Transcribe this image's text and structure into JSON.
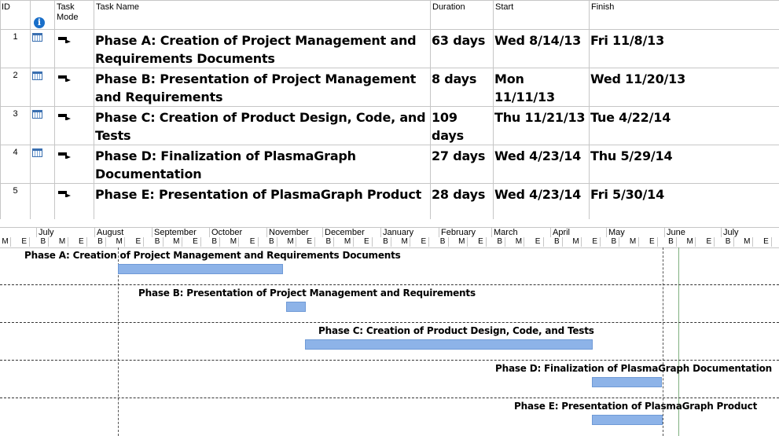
{
  "columns": {
    "id": "ID",
    "task_mode_line1": "Task",
    "task_mode_line2": "Mode",
    "task_name": "Task Name",
    "duration": "Duration",
    "start": "Start",
    "finish": "Finish"
  },
  "tasks": [
    {
      "id": "1",
      "name": "Phase A: Creation of Project Management and Requirements Documents",
      "duration": "63 days",
      "start": "Wed 8/14/13",
      "finish": "Fri 11/8/13",
      "calendar_icon": true
    },
    {
      "id": "2",
      "name": "Phase B: Presentation of Project Management and Requirements",
      "duration": "8 days",
      "start": "Mon 11/11/13",
      "finish": "Wed 11/20/13",
      "calendar_icon": true
    },
    {
      "id": "3",
      "name": "Phase C: Creation of Product Design, Code, and Tests",
      "duration": "109 days",
      "start": "Thu 11/21/13",
      "finish": "Tue 4/22/14",
      "calendar_icon": true
    },
    {
      "id": "4",
      "name": "Phase D: Finalization of PlasmaGraph Documentation",
      "duration": "27 days",
      "start": "Wed 4/23/14",
      "finish": "Thu 5/29/14",
      "calendar_icon": true
    },
    {
      "id": "5",
      "name": "Phase E: Presentation of PlasmaGraph Product",
      "duration": "28 days",
      "start": "Wed 4/23/14",
      "finish": "Fri 5/30/14",
      "calendar_icon": false
    }
  ],
  "timescale": {
    "months": [
      "July",
      "August",
      "September",
      "October",
      "November",
      "December",
      "January",
      "February",
      "March",
      "April",
      "May",
      "June",
      "July"
    ],
    "sub_labels": [
      "M",
      "E",
      "B",
      "M",
      "E",
      "B",
      "M",
      "E",
      "B",
      "M",
      "E",
      "B",
      "M",
      "E",
      "B",
      "M",
      "E",
      "B",
      "M",
      "E",
      "B",
      "M",
      "E",
      "B",
      "M",
      "E",
      "B",
      "M",
      "E",
      "B",
      "M",
      "E",
      "B",
      "M",
      "E",
      "B",
      "M",
      "E",
      "B",
      "M",
      "E"
    ]
  },
  "gantt": {
    "bar_labels": [
      "Phase A: Creation of Project Management and Requirements Documents",
      "Phase B: Presentation of Project Management and Requirements",
      "Phase C: Creation of Product Design, Code, and Tests",
      "Phase D: Finalization of PlasmaGraph Documentation",
      "Phase E: Presentation of PlasmaGraph Product"
    ]
  },
  "icons": {
    "indicator_header": "info-icon",
    "row_indicator": "calendar-icon",
    "task_mode": "auto-scheduled-task-icon"
  },
  "colors": {
    "bar_fill": "#8db3e8",
    "info_icon": "#1a6fc9",
    "today_line": "#7fb07f"
  }
}
